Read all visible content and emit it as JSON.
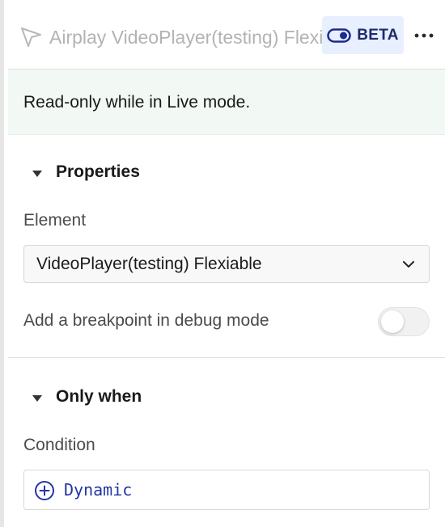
{
  "header": {
    "title": "Airplay VideoPlayer(testing) Flexiable",
    "beta_label": "BETA"
  },
  "notice": {
    "text": "Read-only while in Live mode."
  },
  "properties": {
    "title": "Properties",
    "element_label": "Element",
    "element_value": "VideoPlayer(testing) Flexiable",
    "breakpoint_label": "Add a breakpoint in debug mode",
    "breakpoint_on": false
  },
  "only_when": {
    "title": "Only when",
    "condition_label": "Condition",
    "condition_value": "Dynamic"
  },
  "colors": {
    "accent": "#2435a6",
    "beta_bg": "#e8efff",
    "notice_bg": "#f2f8f3"
  },
  "icons": [
    "cursor-icon",
    "toggle-icon",
    "more-icon",
    "caret-down-icon",
    "chevron-down-icon",
    "plus-circle-icon"
  ]
}
